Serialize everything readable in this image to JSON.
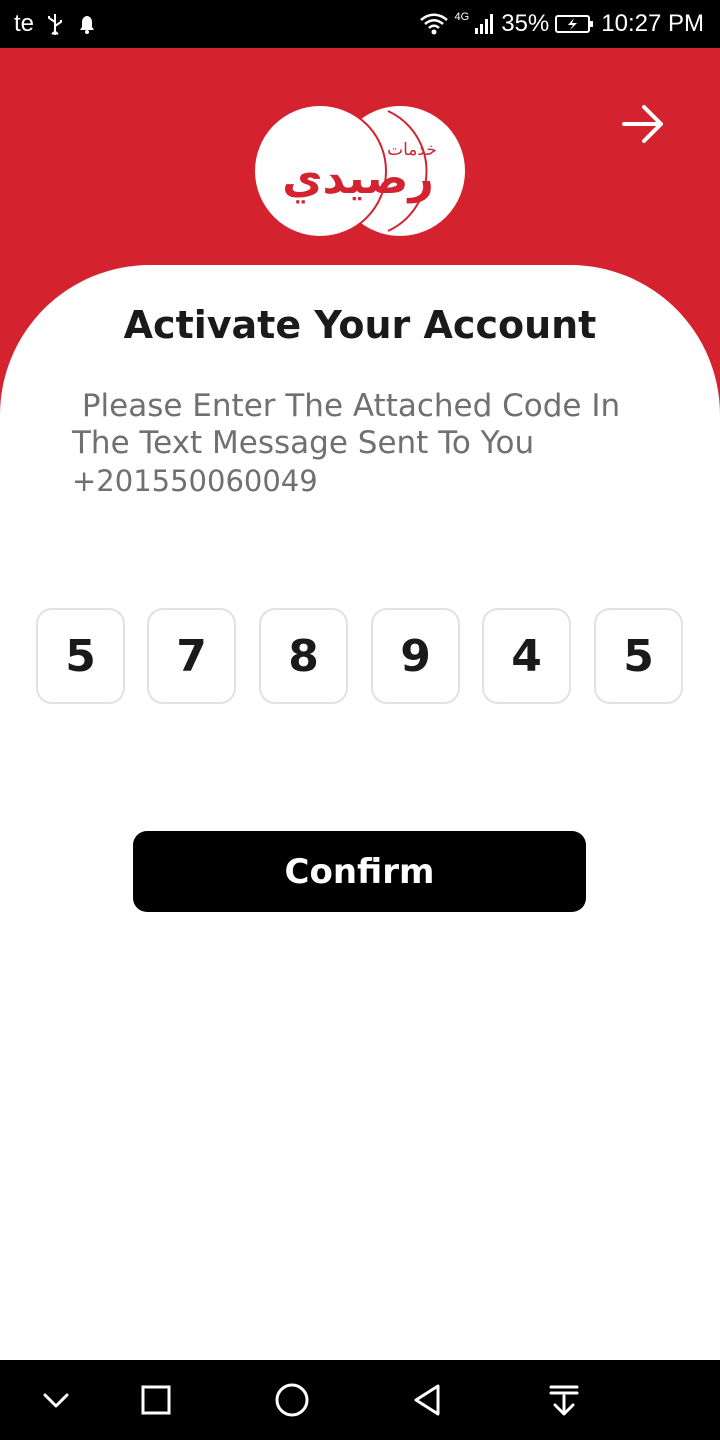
{
  "status_bar": {
    "carrier": "te",
    "network_type": "4G",
    "battery_percent": "35%",
    "time": "10:27 PM",
    "icons": [
      "usb-icon",
      "notification-bell-icon",
      "wifi-icon",
      "cellular-signal-icon",
      "battery-charging-icon"
    ]
  },
  "header": {
    "logo_text_small": "خدمات",
    "logo_text_large": "رصيدي",
    "back_icon": "arrow-right-icon",
    "accent_color": "#d4232f"
  },
  "main": {
    "title": "Activate Your Account",
    "message": " Please Enter The Attached Code In\nThe Text Message Sent To You",
    "phone": "+201550060049",
    "code_digits": [
      "5",
      "7",
      "8",
      "9",
      "4",
      "5"
    ],
    "confirm_label": "Confirm"
  },
  "nav_bar": {
    "icons": [
      "chevron-down-icon",
      "recents-square-icon",
      "home-circle-icon",
      "back-triangle-icon",
      "notification-pull-icon"
    ]
  }
}
